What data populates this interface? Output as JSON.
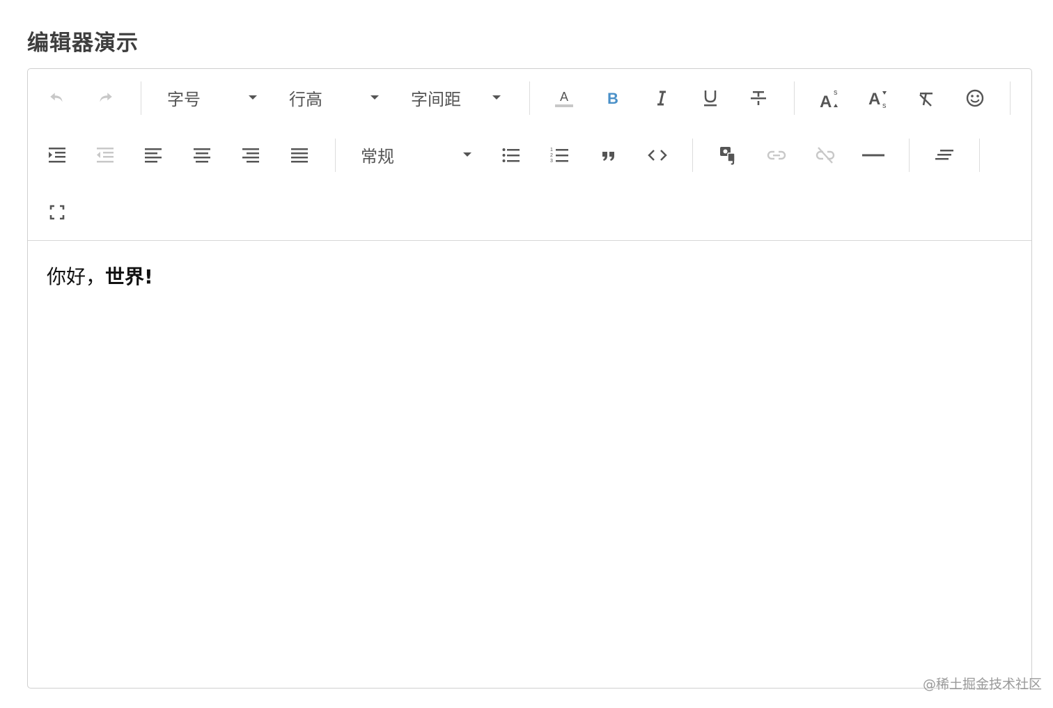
{
  "page": {
    "title": "编辑器演示"
  },
  "toolbar": {
    "font_size_label": "字号",
    "line_height_label": "行高",
    "letter_spacing_label": "字间距",
    "block_type_label": "常规",
    "icons": [
      "undo-icon",
      "redo-icon",
      "font-color-icon",
      "bold-icon",
      "italic-icon",
      "underline-icon",
      "strikethrough-icon",
      "superscript-icon",
      "subscript-icon",
      "clear-format-icon",
      "emoji-icon",
      "indent-increase-icon",
      "indent-decrease-icon",
      "align-left-icon",
      "align-center-icon",
      "align-right-icon",
      "align-justify-icon",
      "unordered-list-icon",
      "ordered-list-icon",
      "blockquote-icon",
      "code-icon",
      "media-icon",
      "link-icon",
      "unlink-icon",
      "horizontal-rule-icon",
      "remove-styles-icon",
      "fullscreen-icon"
    ]
  },
  "content": {
    "text_normal": "你好，",
    "text_bold": "世界!"
  },
  "watermark": "@稀土掘金技术社区",
  "colors": {
    "accent": "#4a90c8",
    "icon": "#555555",
    "icon_disabled": "#c8c8c8",
    "border": "#cfcfcf"
  }
}
